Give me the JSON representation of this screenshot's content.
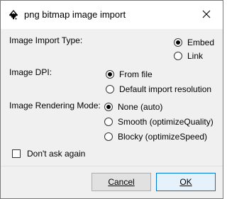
{
  "window": {
    "title": "png bitmap image import",
    "app_icon": "inkscape-icon",
    "close_icon": "close-icon"
  },
  "import_type": {
    "label": "Image Import Type:",
    "options": [
      {
        "label": "Embed",
        "checked": true
      },
      {
        "label": "Link",
        "checked": false
      }
    ]
  },
  "dpi": {
    "label": "Image DPI:",
    "options": [
      {
        "label": "From file",
        "checked": true
      },
      {
        "label": "Default import resolution",
        "checked": false
      }
    ]
  },
  "rendering": {
    "label": "Image Rendering Mode:",
    "options": [
      {
        "label": "None (auto)",
        "checked": true
      },
      {
        "label": "Smooth (optimizeQuality)",
        "checked": false
      },
      {
        "label": "Blocky (optimizeSpeed)",
        "checked": false
      }
    ]
  },
  "dont_ask": {
    "label": "Don't ask again",
    "checked": false
  },
  "buttons": {
    "cancel_label": "Cancel",
    "ok_label": "OK"
  },
  "colors": {
    "dialog_bg": "#f0f0f0",
    "titlebar_bg": "#ffffff",
    "ok_border": "#0078d7"
  }
}
